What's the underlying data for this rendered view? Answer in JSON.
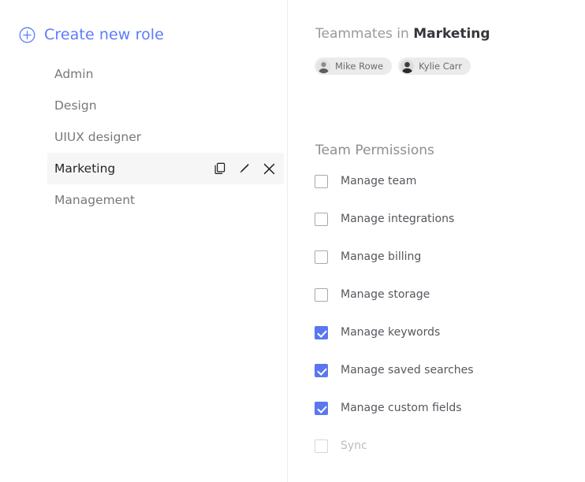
{
  "left": {
    "create_role_label": "Create new role",
    "create_role_icon": "plus-circle-icon",
    "roles": [
      {
        "name": "Admin",
        "selected": false
      },
      {
        "name": "Design",
        "selected": false
      },
      {
        "name": "UIUX designer",
        "selected": false
      },
      {
        "name": "Marketing",
        "selected": true
      },
      {
        "name": "Management",
        "selected": false
      }
    ],
    "row_actions": {
      "duplicate_icon": "copy-icon",
      "edit_icon": "pencil-icon",
      "delete_icon": "close-x-icon"
    }
  },
  "right": {
    "teammates": {
      "title_prefix": "Teammates in ",
      "role_name": "Marketing",
      "members": [
        {
          "name": "Mike Rowe"
        },
        {
          "name": "Kylie Carr"
        }
      ]
    },
    "permissions": {
      "title": "Team Permissions",
      "items": [
        {
          "label": "Manage team",
          "checked": false,
          "disabled": false
        },
        {
          "label": "Manage integrations",
          "checked": false,
          "disabled": false
        },
        {
          "label": "Manage billing",
          "checked": false,
          "disabled": false
        },
        {
          "label": "Manage storage",
          "checked": false,
          "disabled": false
        },
        {
          "label": "Manage keywords",
          "checked": true,
          "disabled": false
        },
        {
          "label": "Manage saved searches",
          "checked": true,
          "disabled": false
        },
        {
          "label": "Manage custom fields",
          "checked": true,
          "disabled": false
        },
        {
          "label": "Sync",
          "checked": false,
          "disabled": true
        }
      ]
    }
  },
  "colors": {
    "accent_blue": "#5b7cfa",
    "checkbox_blue": "#5b77ef",
    "selected_row_bg": "#f6f6f6",
    "divider": "#ededed",
    "text_muted": "#787878",
    "text_dark": "#24262b"
  }
}
